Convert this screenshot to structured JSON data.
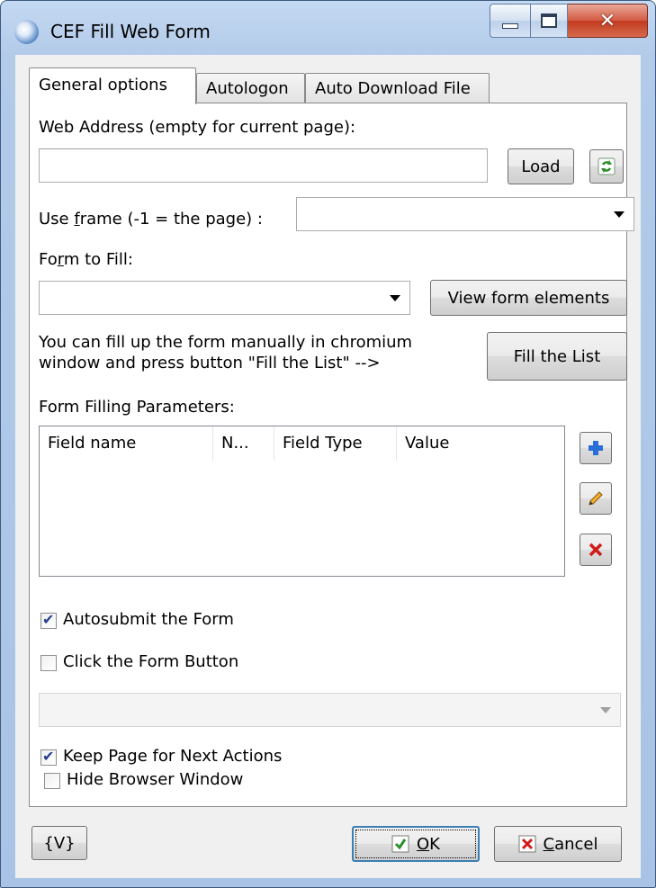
{
  "window": {
    "title": "CEF Fill Web Form"
  },
  "tabs": [
    {
      "label": "General options",
      "active": true
    },
    {
      "label": "Autologon",
      "active": false
    },
    {
      "label": "Auto Download File",
      "active": false
    }
  ],
  "web_address": {
    "label": "Web Address (empty for current page):",
    "value": "",
    "load_label": "Load",
    "refresh_icon": "refresh-icon"
  },
  "frame": {
    "label_pre": "Use ",
    "label_u": "f",
    "label_post": "rame (-1 = the page) :",
    "value": ""
  },
  "form": {
    "label_pre": "Fo",
    "label_u": "r",
    "label_post": "m to Fill:",
    "value": "",
    "view_label": "View form elements"
  },
  "hint": {
    "line1": "You can fill up the form manually in chromium",
    "line2": "window and press button \"Fill the List\" -->",
    "fill_label": "Fill the List"
  },
  "params": {
    "label": "Form Filling Parameters:",
    "columns": [
      "Field name",
      "N...",
      "Field Type",
      "Value"
    ],
    "rows": []
  },
  "options": {
    "autosubmit": {
      "label": "Autosubmit the Form",
      "checked": true
    },
    "click_button": {
      "label": "Click the Form Button",
      "checked": false
    },
    "button_select_value": "",
    "keep_page": {
      "label": "Keep Page for Next Actions",
      "checked": true
    },
    "hide_browser": {
      "label": "Hide Browser Window",
      "checked": false
    }
  },
  "footer": {
    "var_label": "{V}",
    "ok_u": "O",
    "ok_rest": "K",
    "cancel_u": "C",
    "cancel_rest": "ancel"
  },
  "colors": {
    "accent_blue": "#2a6fd6",
    "delete_red": "#d11a1a",
    "check_green": "#2f8f2f"
  }
}
